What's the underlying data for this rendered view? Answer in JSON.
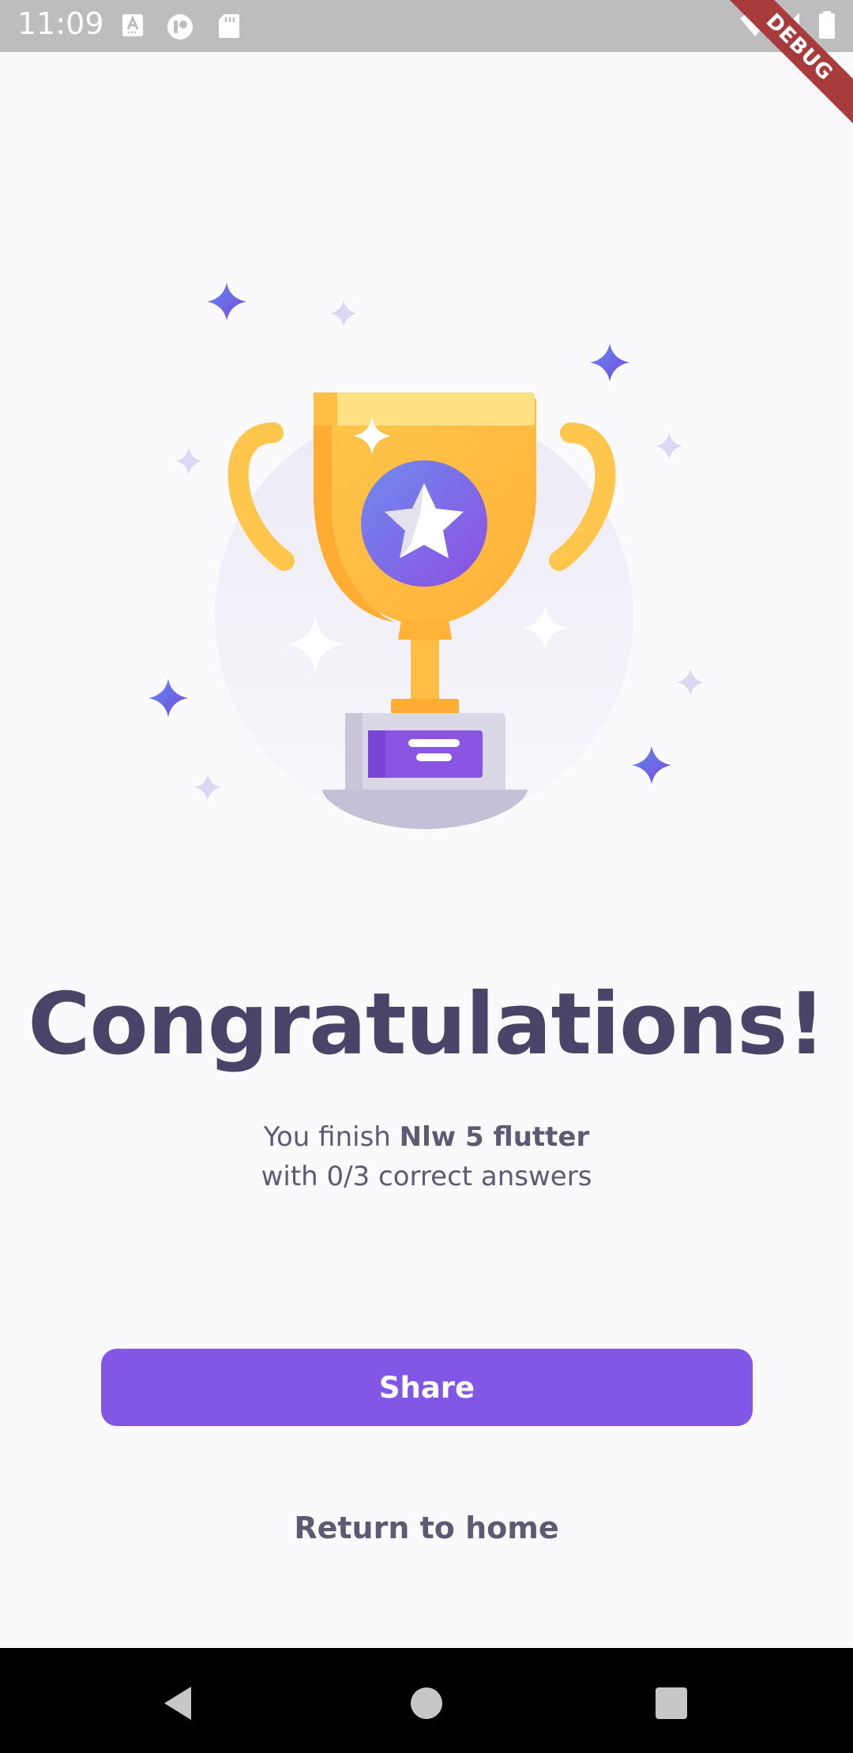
{
  "status_bar": {
    "time": "11:09",
    "debug_label": "DEBUG",
    "icons": [
      "a-keyboard-icon",
      "notification-app-icon",
      "sd-card-icon",
      "wifi-icon",
      "signal-icon",
      "battery-icon"
    ]
  },
  "result": {
    "title": "Congratulations!",
    "line1_prefix": "You finish ",
    "quiz_name": "Nlw 5 flutter",
    "line2": "with 0/3 correct answers"
  },
  "actions": {
    "share_label": "Share",
    "home_label": "Return to home"
  },
  "colors": {
    "primary": "#8257E5",
    "heading": "#4A4469",
    "body_text": "#5E5A73",
    "background": "#FAFAFC",
    "trophy_gold": "#FFBE45",
    "debug_ribbon": "#A83C3C"
  },
  "nav_bar": {
    "icons": [
      "back-icon",
      "home-icon",
      "recents-icon"
    ]
  }
}
